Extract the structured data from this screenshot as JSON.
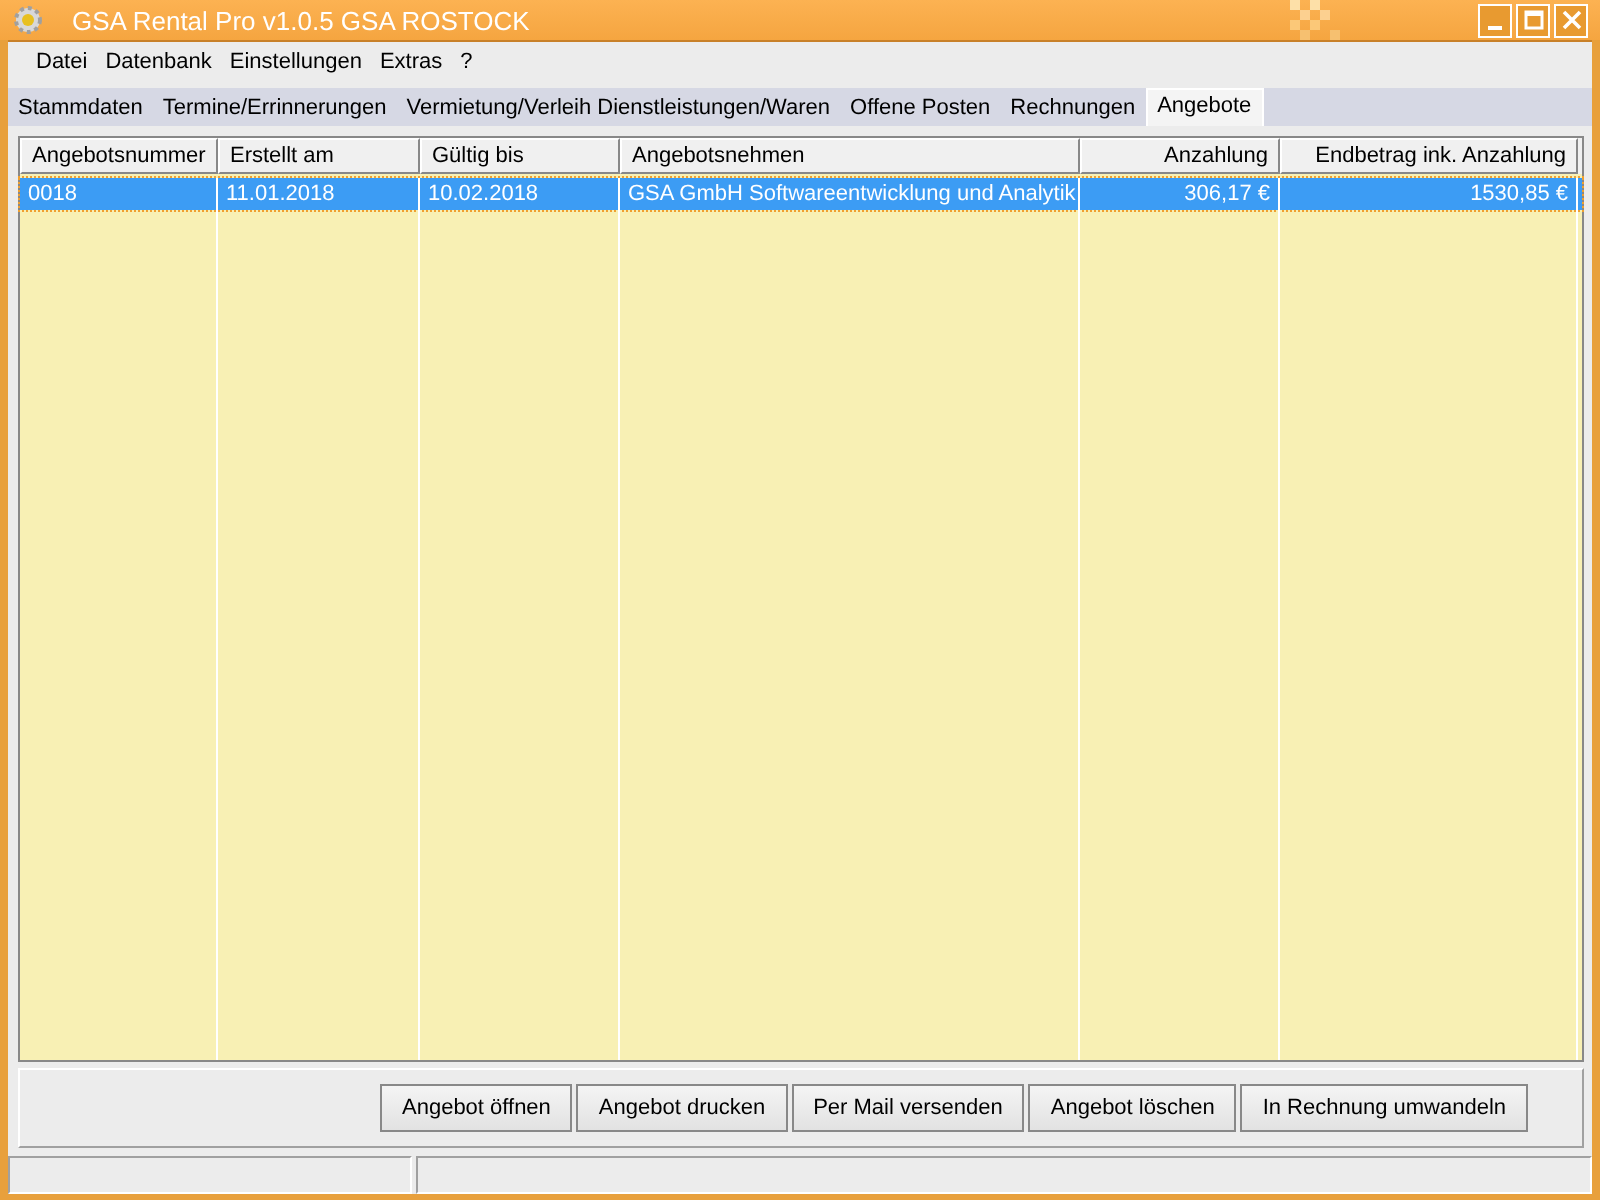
{
  "window": {
    "title": "GSA Rental Pro v1.0.5  GSA ROSTOCK"
  },
  "menu": [
    "Datei",
    "Datenbank",
    "Einstellungen",
    "Extras",
    "?"
  ],
  "tabs": [
    {
      "label": "Stammdaten",
      "selected": false
    },
    {
      "label": "Termine/Errinnerungen",
      "selected": false
    },
    {
      "label": "Vermietung/Verleih Dienstleistungen/Waren",
      "selected": false
    },
    {
      "label": "Offene Posten",
      "selected": false
    },
    {
      "label": "Rechnungen",
      "selected": false
    },
    {
      "label": "Angebote",
      "selected": true
    }
  ],
  "table": {
    "columns": [
      {
        "label": "Angebotsnummer",
        "kind": "text"
      },
      {
        "label": "Erstellt am",
        "kind": "text"
      },
      {
        "label": "Gültig bis",
        "kind": "text"
      },
      {
        "label": "Angebotsnehmen",
        "kind": "text"
      },
      {
        "label": "Anzahlung",
        "kind": "amount"
      },
      {
        "label": "Endbetrag ink. Anzahlung",
        "kind": "amount"
      }
    ],
    "rows": [
      {
        "selected": true,
        "cells": [
          "0018",
          "11.01.2018",
          "10.02.2018",
          "GSA GmbH Softwareentwicklung und Analytik",
          "306,17 €",
          "1530,85 €"
        ]
      }
    ]
  },
  "buttons": [
    "Angebot öffnen",
    "Angebot drucken",
    "Per Mail versenden",
    "Angebot löschen",
    "In Rechnung umwandeln"
  ]
}
